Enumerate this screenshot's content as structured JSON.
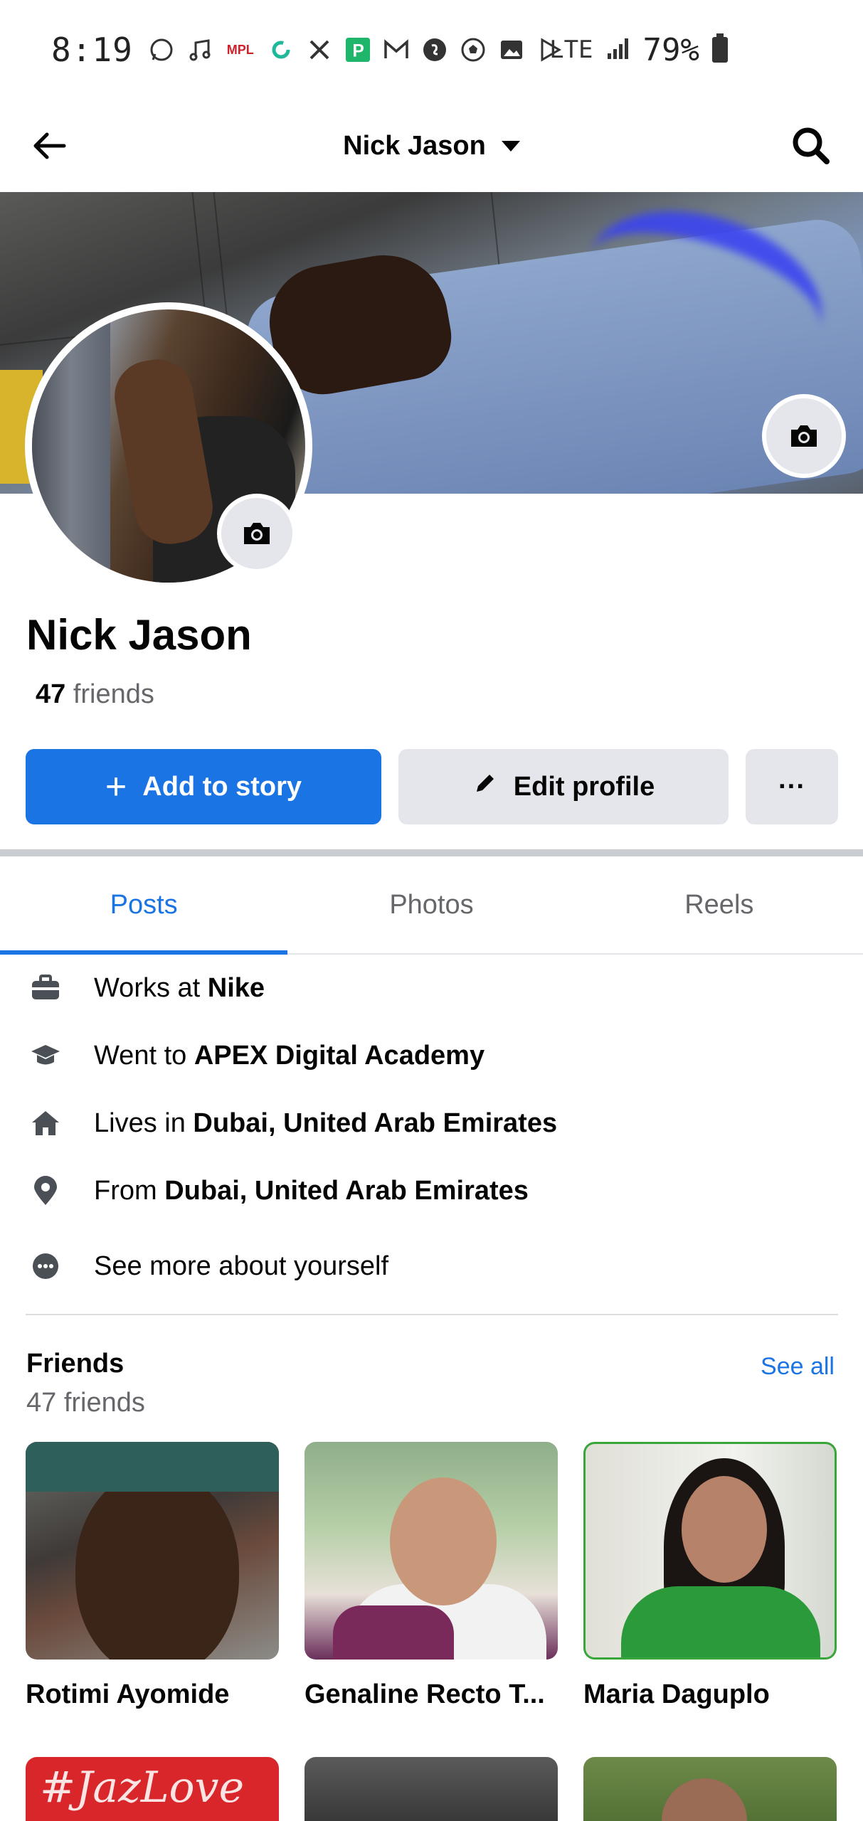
{
  "status_bar": {
    "time": "8:19",
    "network": "LTE",
    "battery": "79%",
    "icons": [
      "whatsapp-icon",
      "music-icon",
      "mpl-icon",
      "circle-app-icon",
      "x-icon",
      "p-app-icon",
      "gmail-icon",
      "shazam-icon",
      "soccer-icon",
      "gallery-icon",
      "play-store-icon"
    ],
    "mpl_label": "MPL"
  },
  "header": {
    "title": "Nick Jason"
  },
  "profile": {
    "name": "Nick Jason",
    "friends_count": "47",
    "friends_label": "friends"
  },
  "actions": {
    "add_story": "Add to story",
    "edit_profile": "Edit profile",
    "more": "···"
  },
  "tabs": [
    {
      "label": "Posts",
      "active": true
    },
    {
      "label": "Photos",
      "active": false
    },
    {
      "label": "Reels",
      "active": false
    }
  ],
  "intro": [
    {
      "icon": "briefcase-icon",
      "prefix": "Works at ",
      "value": "Nike"
    },
    {
      "icon": "graduation-cap-icon",
      "prefix": "Went to ",
      "value": "APEX Digital Academy"
    },
    {
      "icon": "home-icon",
      "prefix": "Lives in ",
      "value": "Dubai, United Arab Emirates"
    },
    {
      "icon": "location-pin-icon",
      "prefix": "From ",
      "value": "Dubai, United Arab Emirates"
    },
    {
      "icon": "more-dots-icon",
      "prefix": "See more about yourself",
      "value": ""
    }
  ],
  "friends": {
    "title": "Friends",
    "subtitle": "47 friends",
    "see_all": "See all",
    "list": [
      {
        "name": "Rotimi Ayomide"
      },
      {
        "name": "Genaline Recto T..."
      },
      {
        "name": "Maria Daguplo"
      }
    ],
    "row2_text": "#JazLove"
  },
  "colors": {
    "accent": "#1b74e4",
    "secondary_button": "#e4e6eb",
    "muted_text": "#65676b"
  }
}
